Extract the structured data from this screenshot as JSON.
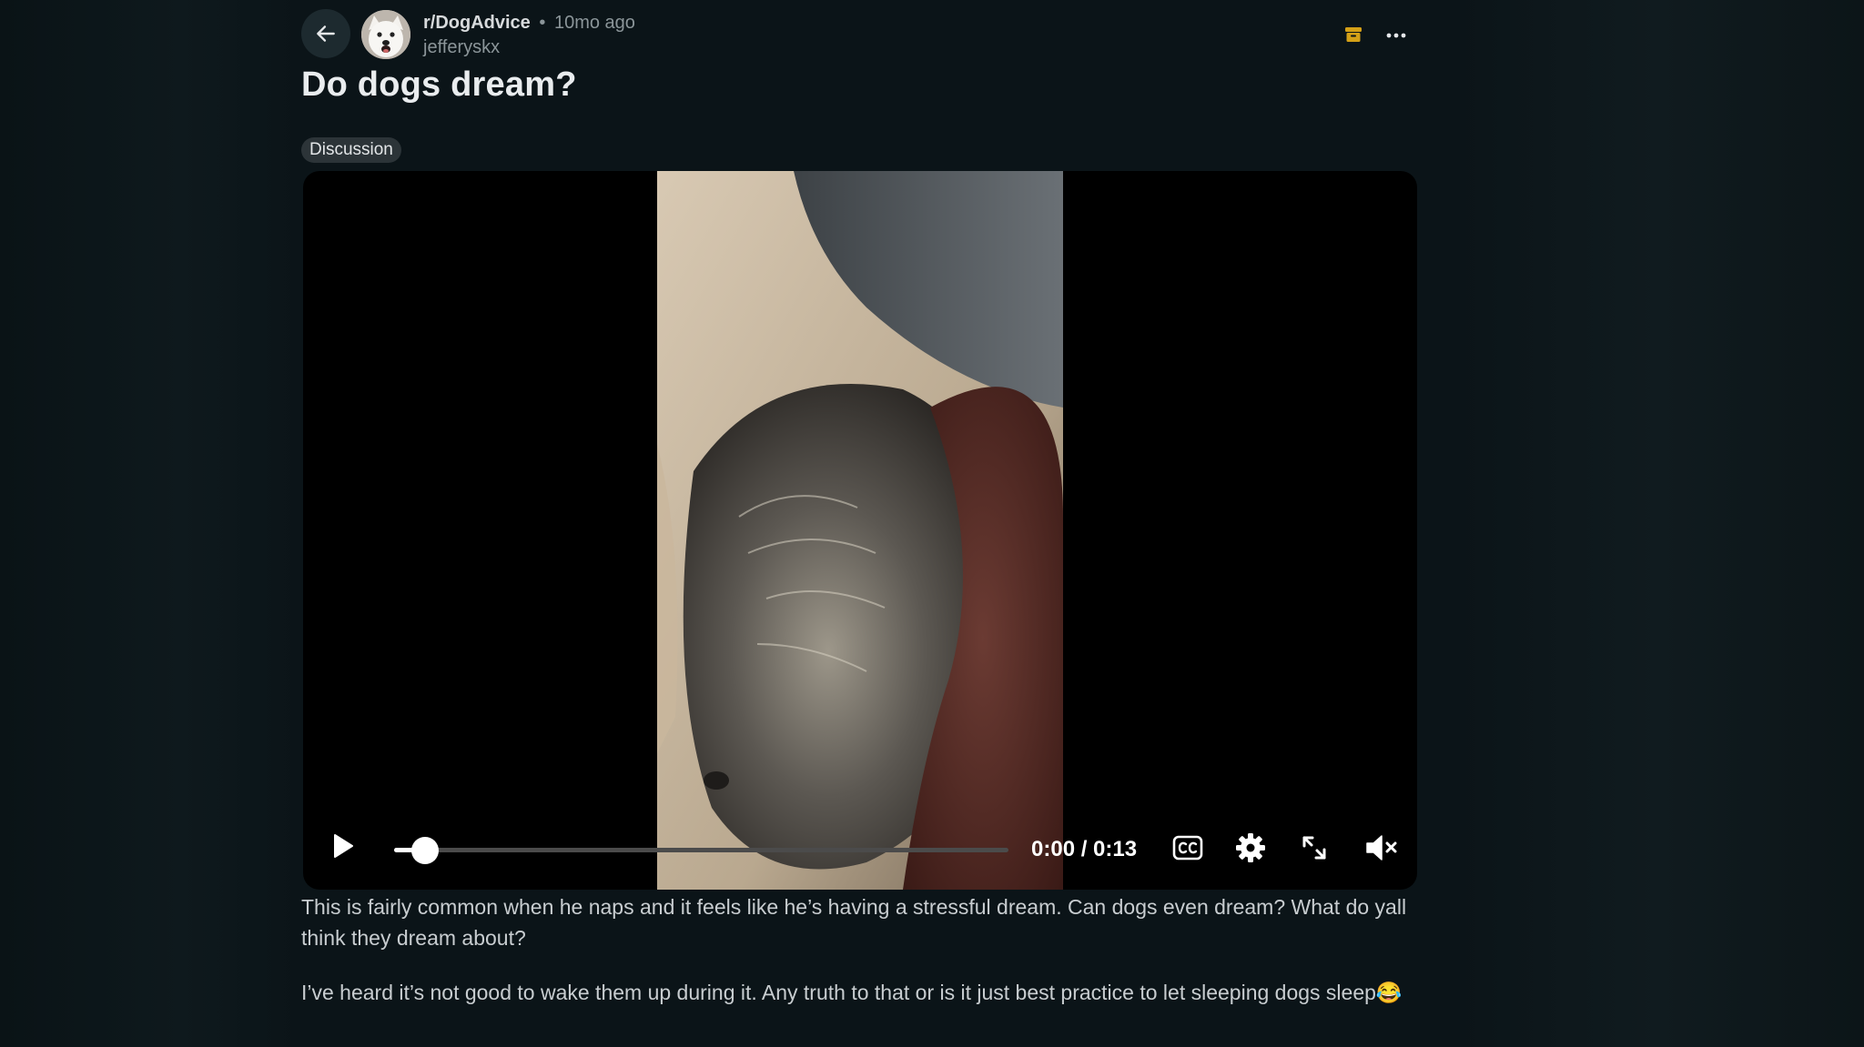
{
  "post": {
    "subreddit": "r/DogAdvice",
    "separator": "•",
    "time_ago": "10mo ago",
    "author": "jefferyskx",
    "title": "Do dogs dream?",
    "flair": "Discussion"
  },
  "video": {
    "current_time": "0:00",
    "duration": "0:13",
    "time_display": "0:00 / 0:13",
    "progress_fraction": 0.05,
    "muted": true
  },
  "body": {
    "paragraph_1": "This is fairly common when he naps and it feels like he’s having a stressful dream. Can dogs even dream? What do yall think they dream about?",
    "paragraph_2": "I’ve heard it’s not good to wake them up during it. Any truth to that or is it just best practice to let sleeping dogs sleep😂"
  },
  "icons": {
    "back": "arrow-left-icon",
    "archive": "archive-icon",
    "more": "more-horizontal-icon",
    "play": "play-icon",
    "captions": "closed-captions-icon",
    "settings": "gear-icon",
    "fullscreen": "expand-icon",
    "volume": "volume-muted-icon"
  },
  "colors": {
    "background": "#0b1418",
    "archive_accent": "#d4a017",
    "flair_bg": "#2c3438",
    "muted_text": "#8b9599"
  }
}
